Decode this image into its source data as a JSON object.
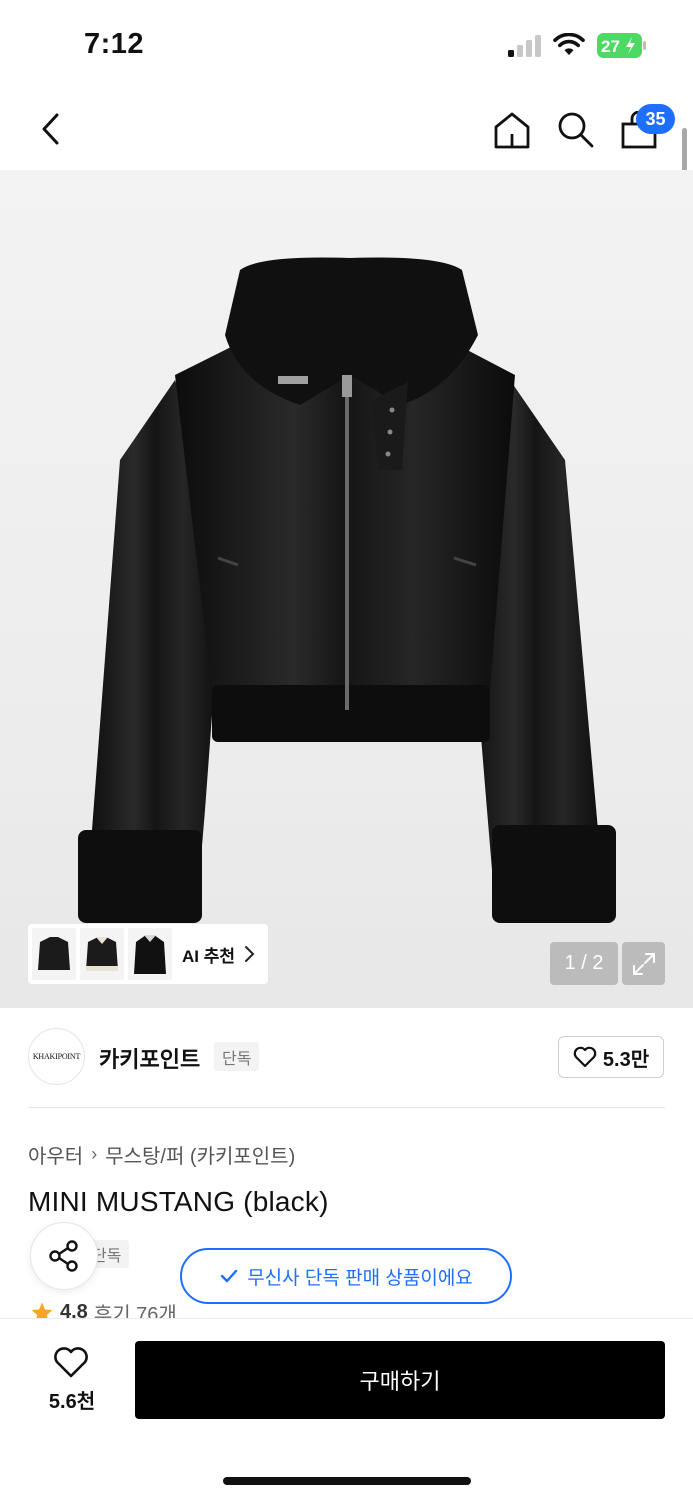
{
  "status_bar": {
    "time": "7:12",
    "battery": "27",
    "icons": [
      "signal-icon",
      "wifi-icon",
      "battery-charging-icon"
    ]
  },
  "nav": {
    "cart_count": "35",
    "icons": [
      "back-icon",
      "home-icon",
      "search-icon",
      "shopping-bag-icon"
    ]
  },
  "gallery": {
    "ai_label": "AI 추천",
    "page_indicator": "1 / 2"
  },
  "brand": {
    "logo_text": "KHAKIPOINT",
    "name": "카키포인트",
    "tag": "단독",
    "likes": "5.3만"
  },
  "breadcrumb": {
    "level1": "아우터",
    "level2": "무스탕/퍼 (카키포인트)"
  },
  "product": {
    "title": "MINI MUSTANG (black)",
    "exclusive_tag": "단독",
    "rating": "4.8",
    "reviews": "후기 76개"
  },
  "toast": {
    "text": "무신사 단독 판매 상품이에요"
  },
  "bottom_bar": {
    "wish_count": "5.6천",
    "buy_label": "구매하기"
  },
  "colors": {
    "accent": "#1e6fff",
    "buy_button": "#000000",
    "star": "#f5a623"
  }
}
